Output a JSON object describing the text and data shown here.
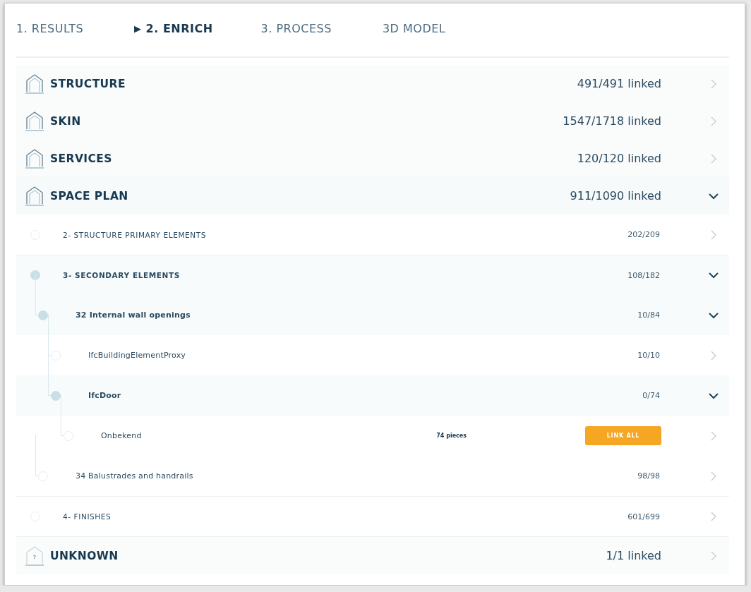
{
  "tabs": [
    {
      "label": "1. RESULTS",
      "selected": false
    },
    {
      "label": "2. ENRICH",
      "selected": true,
      "marker": "▶"
    },
    {
      "label": "3. PROCESS",
      "selected": false
    },
    {
      "label": "3D MODEL",
      "selected": false
    }
  ],
  "categories": [
    {
      "name": "STRUCTURE",
      "count": "491/491 linked",
      "expanded": false
    },
    {
      "name": "SKIN",
      "count": "1547/1718 linked",
      "expanded": false
    },
    {
      "name": "SERVICES",
      "count": "120/120 linked",
      "expanded": false
    },
    {
      "name": "SPACE PLAN",
      "count": "911/1090 linked",
      "expanded": true,
      "children": [
        {
          "label": "2- STRUCTURE PRIMARY ELEMENTS",
          "kind": "group",
          "count": "202/209",
          "expanded": false
        },
        {
          "label": "3- SECONDARY ELEMENTS",
          "kind": "group",
          "count": "108/182",
          "expanded": true,
          "children": [
            {
              "label": "32 Internal wall openings",
              "kind": "item",
              "count": "10/84",
              "expanded": true,
              "children": [
                {
                  "label": "IfcBuildingElementProxy",
                  "kind": "item",
                  "count": "10/10",
                  "expanded": false
                },
                {
                  "label": "IfcDoor",
                  "kind": "item",
                  "count": "0/74",
                  "expanded": true,
                  "children": [
                    {
                      "label": "Onbekend",
                      "kind": "leaf",
                      "pieces": "74 pieces",
                      "action": "LINK ALL",
                      "expanded": false
                    }
                  ]
                }
              ]
            },
            {
              "label": "34 Balustrades and handrails",
              "kind": "item",
              "count": "98/98",
              "expanded": false
            }
          ]
        },
        {
          "label": "4- FINISHES",
          "kind": "group",
          "count": "601/699",
          "expanded": false
        }
      ]
    },
    {
      "name": "UNKNOWN",
      "count": "1/1 linked",
      "expanded": false,
      "icon_label": "?"
    }
  ]
}
